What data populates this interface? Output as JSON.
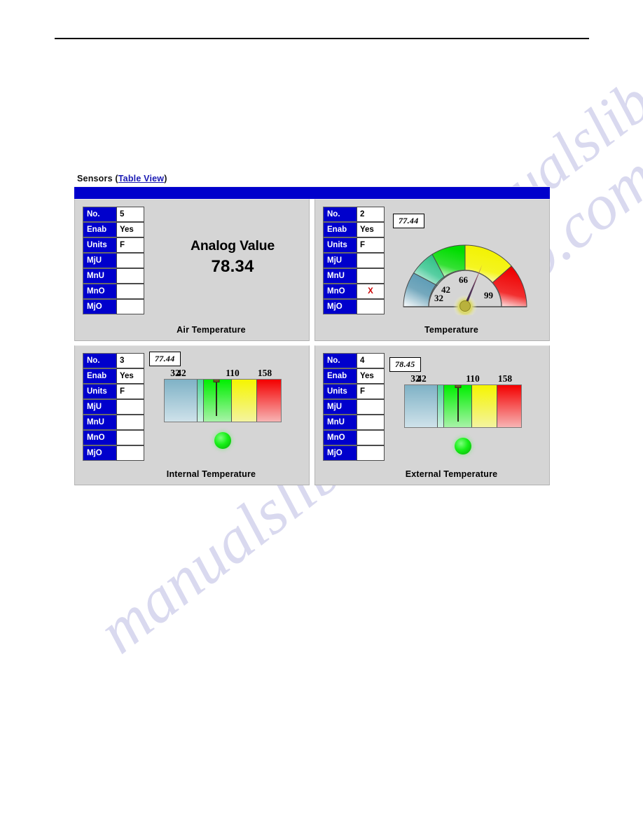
{
  "widget": {
    "header_prefix": "Sensors (",
    "header_link": "Table View",
    "header_suffix": ")"
  },
  "panels": [
    {
      "id": "panel-analog-value",
      "type": "numeric",
      "caption": "Air Temperature",
      "display_title": "Analog Value",
      "display_value": "78.34",
      "properties": [
        {
          "label": "No.",
          "value": "5"
        },
        {
          "label": "Enab",
          "value": "Yes"
        },
        {
          "label": "Units",
          "value": "F"
        },
        {
          "label": "MjU",
          "value": ""
        },
        {
          "label": "MnU",
          "value": ""
        },
        {
          "label": "MnO",
          "value": ""
        },
        {
          "label": "MjO",
          "value": ""
        }
      ]
    },
    {
      "id": "panel-radial-gauge",
      "type": "radial-gauge",
      "caption": "Temperature",
      "readout": "77.44",
      "gauge": {
        "min": 32,
        "max": 158,
        "value": 77.44,
        "tick_labels": [
          "32",
          "42",
          "66",
          "99"
        ],
        "band_colors": [
          "#5b9bb5",
          "#3dbf8e",
          "#00e000",
          "#f2f200",
          "#ee0000"
        ]
      },
      "properties": [
        {
          "label": "No.",
          "value": "2"
        },
        {
          "label": "Enab",
          "value": "Yes"
        },
        {
          "label": "Units",
          "value": "F"
        },
        {
          "label": "MjU",
          "value": ""
        },
        {
          "label": "MnU",
          "value": ""
        },
        {
          "label": "MnO",
          "value": "X",
          "state": "alarm"
        },
        {
          "label": "MjO",
          "value": ""
        }
      ]
    },
    {
      "id": "panel-internal-temperature",
      "type": "bar-gauge",
      "caption": "Internal Temperature",
      "readout": "77.44",
      "bar": {
        "value": 77.44,
        "tick_labels": [
          "32",
          "42",
          "110",
          "158"
        ],
        "led_color": "#18f018"
      },
      "properties": [
        {
          "label": "No.",
          "value": "3"
        },
        {
          "label": "Enab",
          "value": "Yes"
        },
        {
          "label": "Units",
          "value": "F"
        },
        {
          "label": "MjU",
          "value": ""
        },
        {
          "label": "MnU",
          "value": ""
        },
        {
          "label": "MnO",
          "value": ""
        },
        {
          "label": "MjO",
          "value": ""
        }
      ]
    },
    {
      "id": "panel-external-temperature",
      "type": "bar-gauge",
      "caption": "External Temperature",
      "readout": "78.45",
      "bar": {
        "value": 78.45,
        "tick_labels": [
          "32",
          "42",
          "110",
          "158"
        ],
        "led_color": "#18f018"
      },
      "properties": [
        {
          "label": "No.",
          "value": "4"
        },
        {
          "label": "Enab",
          "value": "Yes"
        },
        {
          "label": "Units",
          "value": "F"
        },
        {
          "label": "MjU",
          "value": ""
        },
        {
          "label": "MnU",
          "value": ""
        },
        {
          "label": "MnO",
          "value": ""
        },
        {
          "label": "MjO",
          "value": ""
        }
      ]
    }
  ],
  "watermark": {
    "text": "manualslib.com"
  }
}
